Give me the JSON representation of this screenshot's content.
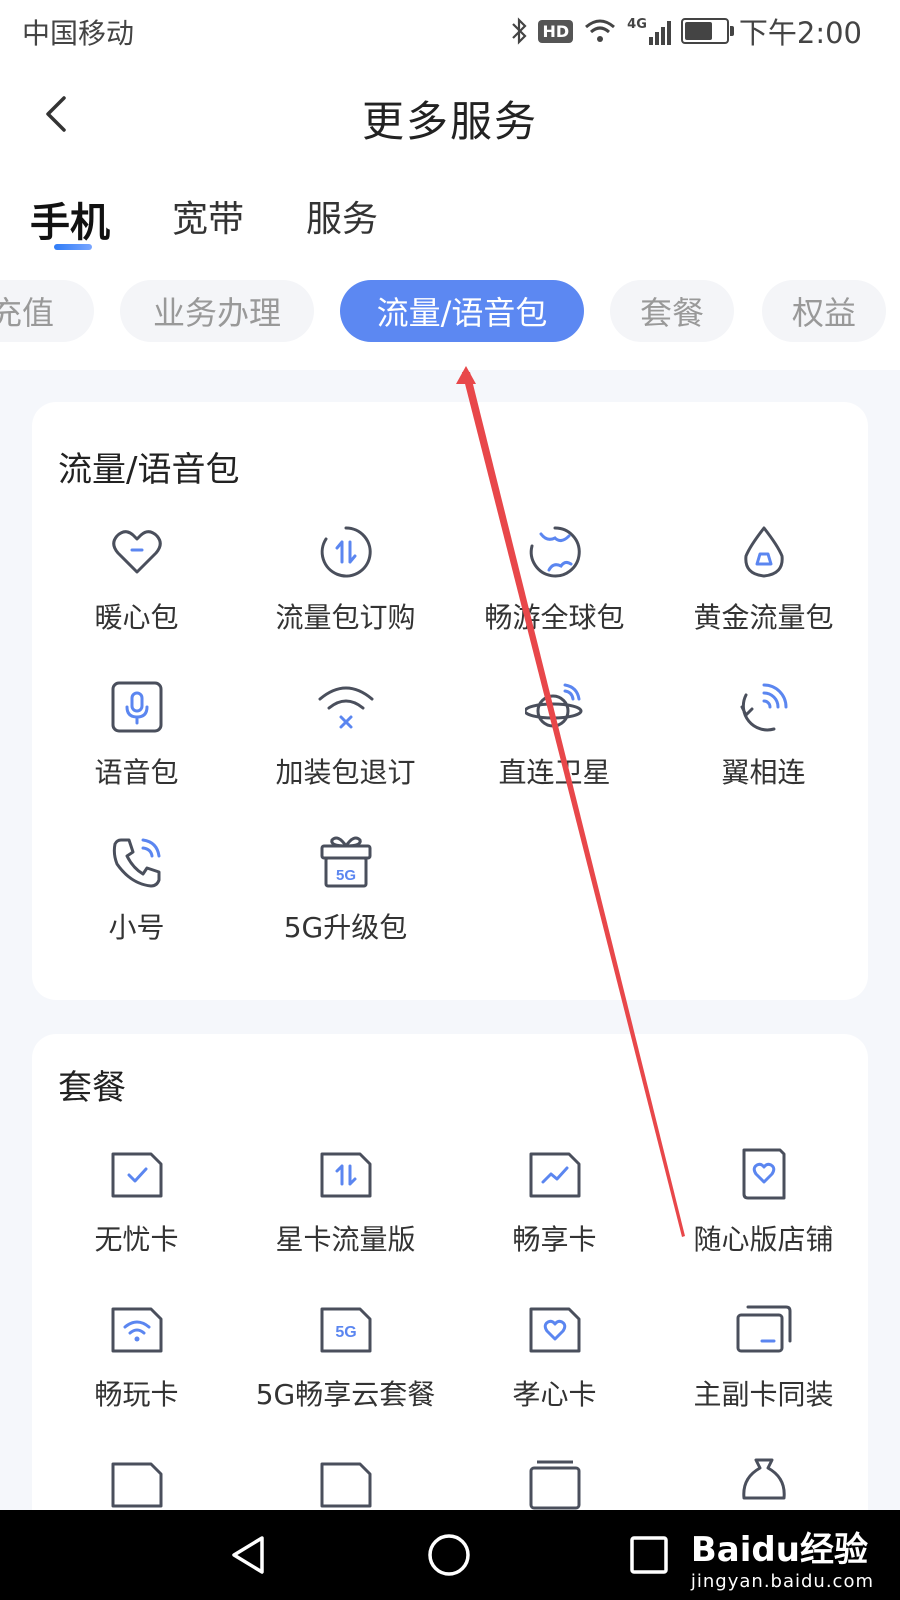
{
  "status_bar": {
    "carrier": "中国移动",
    "hd": "HD",
    "network": "4G",
    "time": "下午2:00"
  },
  "header": {
    "title": "更多服务"
  },
  "main_tabs": [
    {
      "label": "手机",
      "active": true
    },
    {
      "label": "宽带",
      "active": false
    },
    {
      "label": "服务",
      "active": false
    }
  ],
  "chips": [
    {
      "label": "充值",
      "active": false
    },
    {
      "label": "业务办理",
      "active": false
    },
    {
      "label": "流量/语音包",
      "active": true
    },
    {
      "label": "套餐",
      "active": false
    },
    {
      "label": "权益",
      "active": false
    }
  ],
  "sections": [
    {
      "title": "流量/语音包",
      "items": [
        {
          "label": "暖心包",
          "icon": "heart-icon"
        },
        {
          "label": "流量包订购",
          "icon": "data-transfer-icon"
        },
        {
          "label": "畅游全球包",
          "icon": "globe-icon"
        },
        {
          "label": "黄金流量包",
          "icon": "drop-icon"
        },
        {
          "label": "语音包",
          "icon": "microphone-icon"
        },
        {
          "label": "加装包退订",
          "icon": "wifi-cancel-icon"
        },
        {
          "label": "直连卫星",
          "icon": "satellite-icon"
        },
        {
          "label": "翼相连",
          "icon": "connect-signal-icon"
        },
        {
          "label": "小号",
          "icon": "phone-call-icon"
        },
        {
          "label": "5G升级包",
          "icon": "5g-gift-icon"
        }
      ]
    },
    {
      "title": "套餐",
      "items": [
        {
          "label": "无忧卡",
          "icon": "sim-check-icon"
        },
        {
          "label": "星卡流量版",
          "icon": "sim-data-icon"
        },
        {
          "label": "畅享卡",
          "icon": "sim-chart-icon"
        },
        {
          "label": "随心版店铺",
          "icon": "sim-heart-icon"
        },
        {
          "label": "畅玩卡",
          "icon": "sim-wifi-icon"
        },
        {
          "label": "5G畅享云套餐",
          "icon": "sim-5g-icon"
        },
        {
          "label": "孝心卡",
          "icon": "sim-heart-icon"
        },
        {
          "label": "主副卡同装",
          "icon": "dual-card-icon"
        }
      ]
    }
  ],
  "watermark": {
    "brand": "Baidu经验",
    "url": "jingyan.baidu.com"
  },
  "colors": {
    "accent": "#5c88f2",
    "annotation_arrow": "#e8474a",
    "icon_blue": "#5b86f0",
    "icon_gray": "#4a4f5c"
  }
}
